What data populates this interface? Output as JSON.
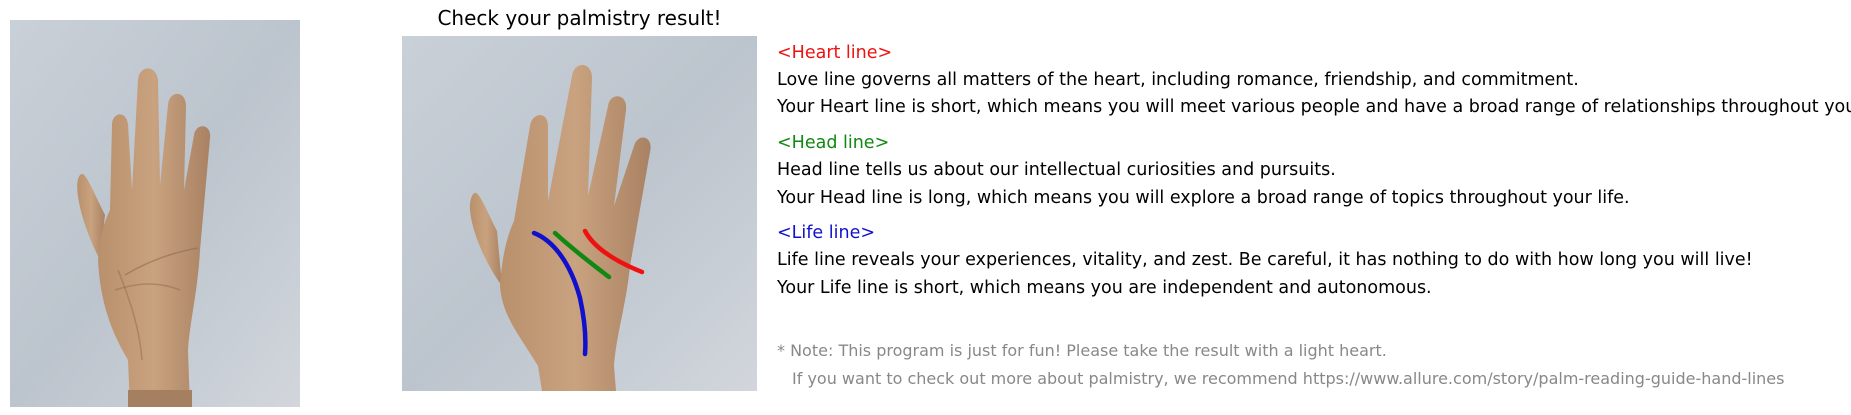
{
  "title": "Check your palmistry result!",
  "input_image": {
    "alt": "palm photo",
    "description_icon": "hand-photo"
  },
  "result_image": {
    "alt": "palm photo with traced lines"
  },
  "lines": [
    {
      "key": "heart",
      "heading": "<Heart line>",
      "color": "#ee1111",
      "description": "Love line governs all matters of the heart, including romance, friendship, and commitment.",
      "result": "Your Heart line is short, which means you will meet various people and have a broad range of relationships throughout your life."
    },
    {
      "key": "head",
      "heading": "<Head line>",
      "color": "#118811",
      "description": "Head line tells us about our intellectual curiosities and pursuits.",
      "result": "Your Head line is long, which means you will explore a broad range of topics throughout your life."
    },
    {
      "key": "life",
      "heading": "<Life line>",
      "color": "#1111cc",
      "description": "Life line reveals your experiences, vitality, and zest. Be careful, it has nothing to do with how long you will live!",
      "result": "Your Life line is short, which means you are independent and autonomous."
    }
  ],
  "note": {
    "line1": "* Note: This program is just for fun! Please take the result with a light heart.",
    "line2": "If you want to check out more about palmistry, we recommend https://www.allure.com/story/palm-reading-guide-hand-lines",
    "color": "#888888"
  }
}
